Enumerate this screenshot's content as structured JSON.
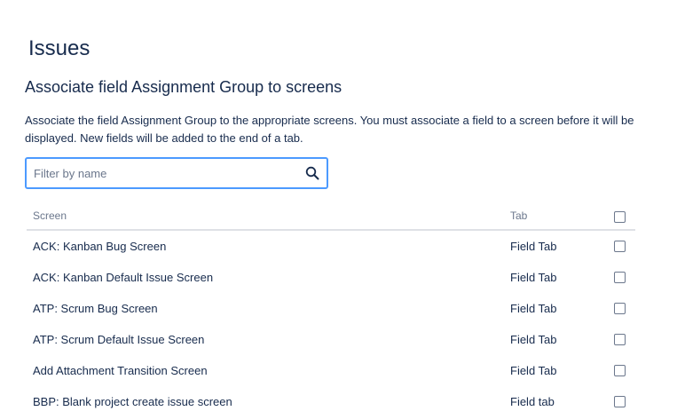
{
  "page": {
    "title": "Issues",
    "section_title": "Associate field Assignment Group to screens",
    "description": "Associate the field Assignment Group to the appropriate screens. You must associate a field to a screen before it will be displayed. New fields will be added to the end of a tab."
  },
  "search": {
    "value": "",
    "placeholder": "Filter by name",
    "icon": "search-icon"
  },
  "table": {
    "columns": {
      "screen": "Screen",
      "tab": "Tab"
    },
    "rows": [
      {
        "screen": "ACK: Kanban Bug Screen",
        "tab": "Field Tab"
      },
      {
        "screen": "ACK: Kanban Default Issue Screen",
        "tab": "Field Tab"
      },
      {
        "screen": "ATP: Scrum Bug Screen",
        "tab": "Field Tab"
      },
      {
        "screen": "ATP: Scrum Default Issue Screen",
        "tab": "Field Tab"
      },
      {
        "screen": "Add Attachment Transition Screen",
        "tab": "Field Tab"
      },
      {
        "screen": "BBP: Blank project create issue screen",
        "tab": "Field tab"
      }
    ]
  },
  "colors": {
    "text": "#172b4d",
    "subtle_text": "#6b778c",
    "focus_border": "#4c9aff",
    "divider": "#dfe1e6"
  }
}
